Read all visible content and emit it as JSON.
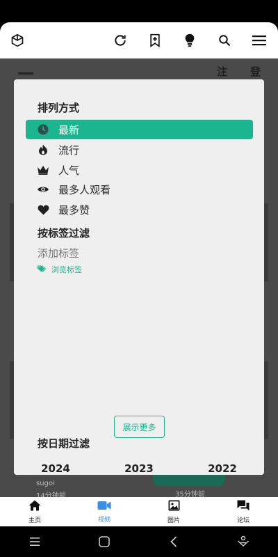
{
  "dialog": {
    "sort_title": "排列方式",
    "sort_options": [
      {
        "label": "最新",
        "icon": "clock-icon",
        "active": true
      },
      {
        "label": "流行",
        "icon": "fire-icon",
        "active": false
      },
      {
        "label": "人气",
        "icon": "crown-icon",
        "active": false
      },
      {
        "label": "最多人观看",
        "icon": "eye-icon",
        "active": false
      },
      {
        "label": "最多赞",
        "icon": "heart-icon",
        "active": false
      }
    ],
    "tag_filter_title": "按标签过滤",
    "add_tag_label": "添加标签",
    "browse_tags_label": "浏览标签",
    "show_more_label": "展示更多",
    "date_filter_title": "按日期过滤",
    "years": [
      "2024",
      "2023",
      "2022"
    ]
  },
  "background": {
    "header_right_1": "注",
    "header_right_2": "登",
    "item_author": "sugoi",
    "item_time_1": "14分钟前",
    "item_time_2": "35分钟前"
  },
  "bottom_nav": {
    "items": [
      {
        "label": "主页",
        "icon": "home-icon"
      },
      {
        "label": "视频",
        "icon": "video-icon",
        "active": true
      },
      {
        "label": "图片",
        "icon": "image-icon"
      },
      {
        "label": "论坛",
        "icon": "forum-icon"
      }
    ]
  },
  "colors": {
    "accent": "#1bb690",
    "active_nav": "#3a8ee6"
  }
}
